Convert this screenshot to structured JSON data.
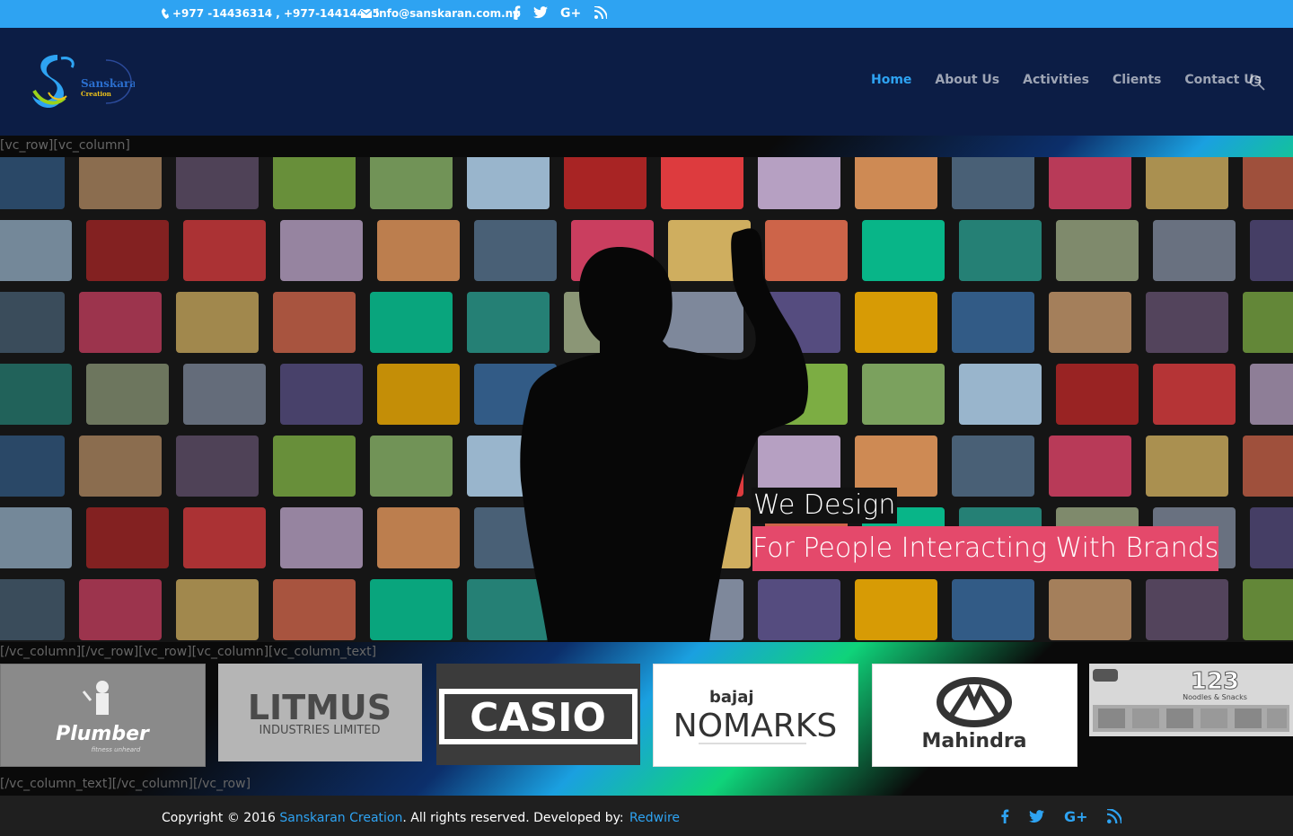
{
  "topbar": {
    "phone": "+977 -14436314 , +977-14414405",
    "email": "info@sanskaran.com.np",
    "social_icons": [
      "facebook-icon",
      "twitter-icon",
      "google-plus-icon",
      "rss-icon"
    ]
  },
  "brand": {
    "logo_text_1": "Sanskaran",
    "logo_text_2": "Creation"
  },
  "nav": {
    "items": [
      {
        "label": "Home",
        "active": true
      },
      {
        "label": "About Us",
        "active": false
      },
      {
        "label": "Activities",
        "active": false
      },
      {
        "label": "Clients",
        "active": false
      },
      {
        "label": "Contact Us",
        "active": false
      }
    ]
  },
  "shortcodes": {
    "top": "[vc_row][vc_column]",
    "middle": "[/vc_column][/vc_row][vc_row][vc_column][vc_column_text]",
    "bottom": "[/vc_column_text][/vc_column][/vc_row]"
  },
  "hero": {
    "line1": "We Design",
    "line2": "For People Interacting With Brands"
  },
  "clients": [
    {
      "name": "Plumber",
      "sub": "fitness unheard"
    },
    {
      "name": "LITMUS",
      "sub": "INDUSTRIES LIMITED"
    },
    {
      "name": "CASIO"
    },
    {
      "name": "NOMARKS",
      "brand": "bajaj"
    },
    {
      "name": "Mahindra"
    },
    {
      "name": "123",
      "sub": "Noodles & Snacks"
    }
  ],
  "footer": {
    "copy_prefix": "Copyright © 2016 ",
    "copy_link": "Sanskaran Creation",
    "copy_suffix": ". All rights reserved. Developed by: ",
    "developer": "Redwire"
  },
  "colors": {
    "accent": "#2ea3f2",
    "header": "#0c1d45",
    "tagline_bg": "#e4496b"
  }
}
